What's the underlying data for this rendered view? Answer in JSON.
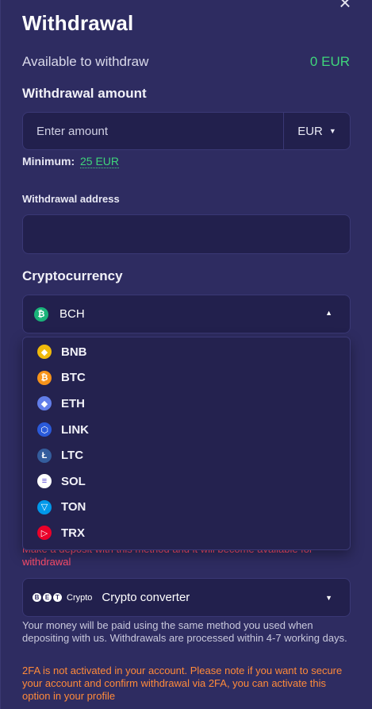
{
  "modal": {
    "title": "Withdrawal",
    "close_glyph": "×"
  },
  "available": {
    "label": "Available to withdraw",
    "value": "0 EUR",
    "value_color": "#3fd67b"
  },
  "amount": {
    "section_label": "Withdrawal amount",
    "placeholder": "Enter amount",
    "currency": "EUR",
    "minimum_label": "Minimum:",
    "minimum_value": "25 EUR"
  },
  "address": {
    "label": "Withdrawal address",
    "value": ""
  },
  "crypto": {
    "section_label": "Cryptocurrency",
    "selected": {
      "code": "BCH",
      "icon": "bch-coin-icon",
      "color": "#1ab37a",
      "glyph": "₿"
    },
    "options": [
      {
        "code": "BNB",
        "icon": "bnb-coin-icon",
        "color": "#f0b90b",
        "glyph": "◆"
      },
      {
        "code": "BTC",
        "icon": "btc-coin-icon",
        "color": "#f7931a",
        "glyph": "₿"
      },
      {
        "code": "ETH",
        "icon": "eth-coin-icon",
        "color": "#627eea",
        "glyph": "◆"
      },
      {
        "code": "LINK",
        "icon": "link-coin-icon",
        "color": "#2a5ada",
        "glyph": "⬡"
      },
      {
        "code": "LTC",
        "icon": "ltc-coin-icon",
        "color": "#345d9d",
        "glyph": "Ł"
      },
      {
        "code": "SOL",
        "icon": "sol-coin-icon",
        "color": "#ffffff",
        "glyph": "≡"
      },
      {
        "code": "TON",
        "icon": "ton-coin-icon",
        "color": "#0098ea",
        "glyph": "▽"
      },
      {
        "code": "TRX",
        "icon": "trx-coin-icon",
        "color": "#eb0029",
        "glyph": "▷"
      }
    ]
  },
  "warning": {
    "text": "Make a deposit with this method and it will become available for withdrawal",
    "color": "#ff4d6b"
  },
  "converter": {
    "brand_letters": [
      "B",
      "E",
      "T"
    ],
    "brand_word": "Crypto",
    "label": "Crypto converter"
  },
  "info": {
    "text": "Your money will be paid using the same method you used when depositing with us. Withdrawals are processed within 4-7 working days."
  },
  "twofa": {
    "text": "2FA is not activated in your account. Please note if you want to secure your account and confirm withdrawal via 2FA, you can activate this option in your profile",
    "color": "#ff8a3a"
  }
}
